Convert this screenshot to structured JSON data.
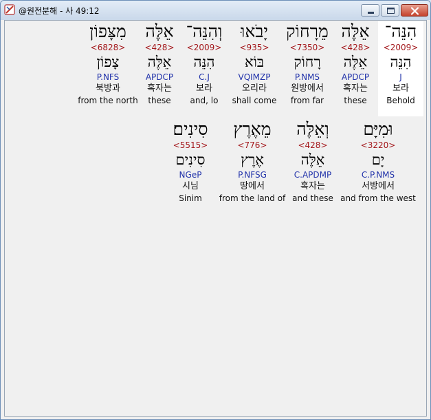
{
  "window": {
    "title": "@원전분해 - 사 49:12",
    "colors": {
      "strong": "#a3171b",
      "parse": "#2233aa",
      "highlight": "#ffffff",
      "close": "#c4422c"
    }
  },
  "rows": [
    {
      "words": [
        {
          "hebrew": "הִנֵּה־",
          "strong": "<2009>",
          "lemma": "הִנֵּה",
          "parse": "J",
          "korean": "보라",
          "english": "Behold",
          "selected": true
        },
        {
          "hebrew": "אֵלֶּה",
          "strong": "<428>",
          "lemma": "אֵלֶּה",
          "parse": "APDCP",
          "korean": "혹자는",
          "english": "these"
        },
        {
          "hebrew": "מֵרָחוֹק",
          "strong": "<7350>",
          "lemma": "רָחוֹק",
          "parse": "P.NMS",
          "korean": "원방에서",
          "english": "from far"
        },
        {
          "hebrew": "יָבֹאוּ",
          "strong": "<935>",
          "lemma": "בּוֹא",
          "parse": "VQIMZP",
          "korean": "오리라",
          "english": "shall come"
        },
        {
          "hebrew": "וְהִנֵּה־",
          "strong": "<2009>",
          "lemma": "הִנֵּה",
          "parse": "C.J",
          "korean": "보라",
          "english": "and, lo"
        },
        {
          "hebrew": "אֵלֶּה",
          "strong": "<428>",
          "lemma": "אֵלֶּה",
          "parse": "APDCP",
          "korean": "혹자는",
          "english": "these"
        },
        {
          "hebrew": "מִצָּפוֹן",
          "strong": "<6828>",
          "lemma": "צָפוֹן",
          "parse": "P.NFS",
          "korean": "북방과",
          "english": "from the north"
        }
      ]
    },
    {
      "words": [
        {
          "hebrew": "וּמִיָּם",
          "strong": "<3220>",
          "lemma": "יָם",
          "parse": "C.P.NMS",
          "korean": "서방에서",
          "english": "and from the west"
        },
        {
          "hebrew": "וְאֵלֶּה",
          "strong": "<428>",
          "lemma": "אֵלֶּה",
          "parse": "C.APDMP",
          "korean": "혹자는",
          "english": "and these"
        },
        {
          "hebrew": "מֵאֶרֶץ",
          "strong": "<776>",
          "lemma": "אֶרֶץ",
          "parse": "P.NFSG",
          "korean": "땅에서",
          "english": "from the land of"
        },
        {
          "hebrew": "סִינִים׃",
          "strong": "<5515>",
          "lemma": "סִינִים",
          "parse": "NGeP",
          "korean": "시님",
          "english": "Sinim"
        }
      ]
    }
  ]
}
